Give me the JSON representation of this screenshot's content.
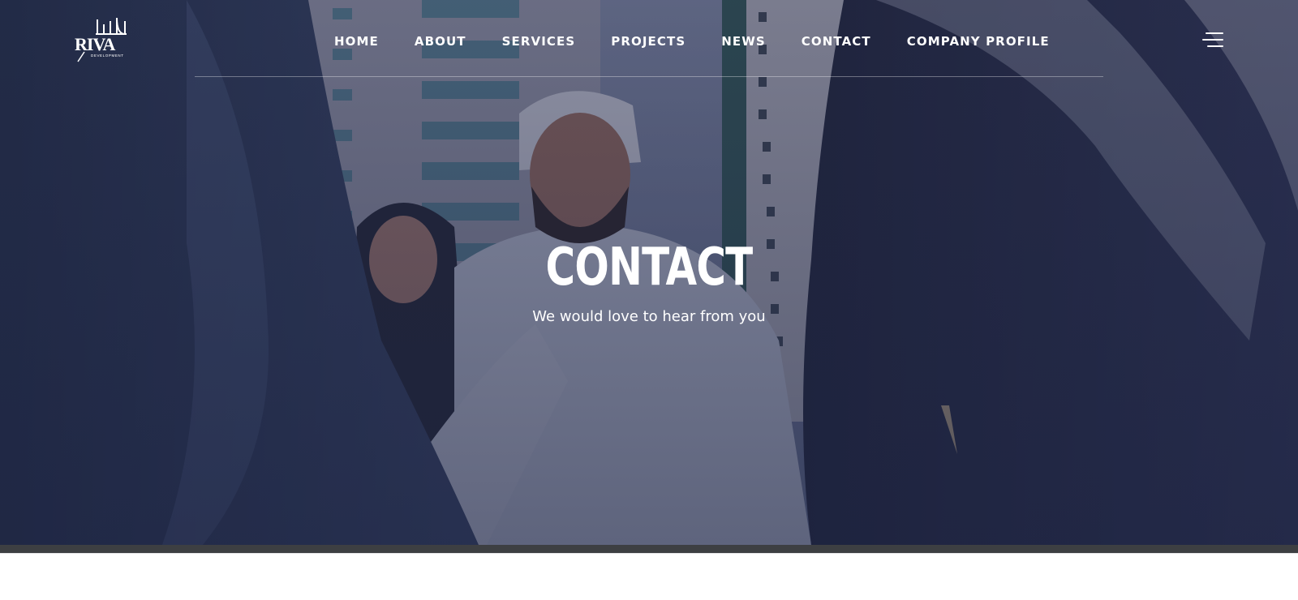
{
  "header": {
    "logo": {
      "wordmark": "RIVA",
      "arabic": "ريفا",
      "tagline": "DEVELOPMENT"
    },
    "nav": [
      "HOME",
      "ABOUT",
      "SERVICES",
      "PROJECTS",
      "NEWS",
      "CONTACT",
      "COMPANY PROFILE"
    ],
    "menu_icon": "hamburger-menu-icon"
  },
  "hero": {
    "title": "CONTACT",
    "subtitle": "We would love to hear from you",
    "background": "photo-handshake-business-people-city"
  },
  "colors": {
    "overlay": "#2c3350",
    "text": "#ffffff",
    "strip": "#3d3f42",
    "page": "#ffffff"
  }
}
